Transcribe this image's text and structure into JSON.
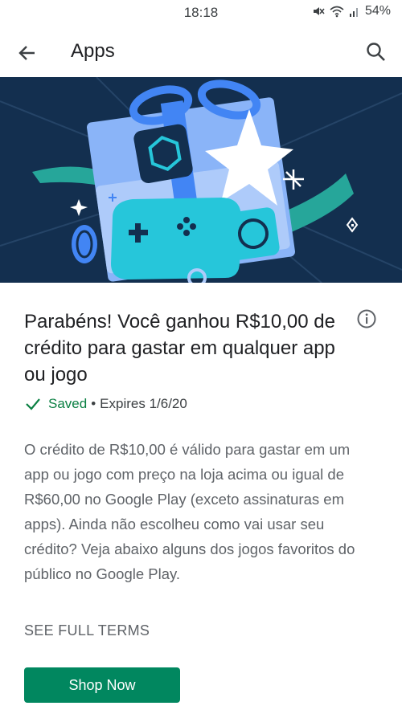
{
  "status_bar": {
    "time": "18:18",
    "battery": "54%",
    "icons": [
      "mute-icon",
      "wifi-icon",
      "signal-icon"
    ]
  },
  "app_bar": {
    "title": "Apps",
    "back_icon": "arrow-back-icon",
    "search_icon": "search-icon"
  },
  "banner": {
    "description_icons": [
      "gift-icon",
      "hexagon-icon",
      "star-icon",
      "gamepad-icon",
      "circle-icon",
      "sparkle-icon",
      "ribbon-icon"
    ]
  },
  "offer": {
    "headline": "Parabéns! Você ganhou R$10,00 de crédito para gastar em qualquer app ou jogo",
    "info_icon": "info-icon",
    "saved_label": "Saved",
    "separator": "•",
    "expires": "Expires 1/6/20",
    "description": "O crédito de R$10,00 é válido para gastar em um app ou jogo com preço na loja acima ou igual de R$60,00 no Google Play (exceto assinaturas em apps). Ainda não escolheu como vai usar seu crédito? Veja abaixo alguns dos jogos favoritos do público no Google Play.",
    "terms_link": "SEE FULL TERMS",
    "shop_button": "Shop Now"
  },
  "colors": {
    "banner_bg": "#132f4f",
    "accent_green": "#01875f",
    "saved_green": "#0b8043",
    "teal": "#26c6da",
    "light_blue": "#8ab4f8",
    "mid_blue": "#4285f4"
  }
}
